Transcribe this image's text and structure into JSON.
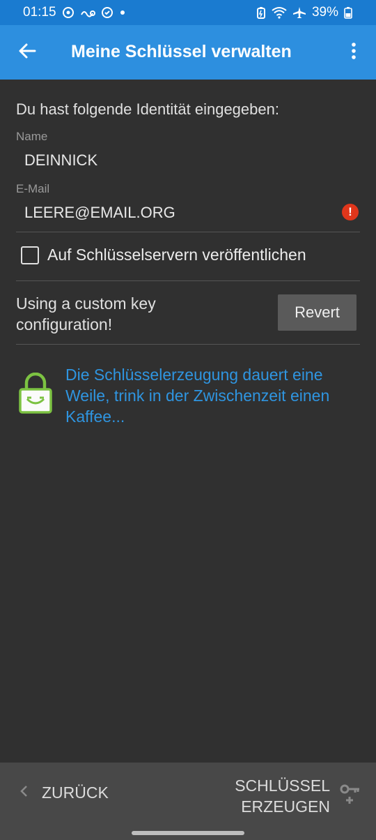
{
  "status_bar": {
    "time": "01:15",
    "battery": "39%",
    "icons": [
      "sync-icon",
      "link-icon",
      "vpn-icon",
      "dot-icon",
      "battery-saver-icon",
      "wifi-icon",
      "airplane-icon",
      "battery-icon"
    ]
  },
  "app_bar": {
    "title": "Meine Schlüssel verwalten",
    "back_icon": "arrow-back-icon",
    "menu_icon": "overflow-menu-icon"
  },
  "form": {
    "intro": "Du hast folgende Identität eingegeben:",
    "name_label": "Name",
    "name_value": "DEINNICK",
    "email_label": "E-Mail",
    "email_value": "LEERE@EMAIL.ORG",
    "email_error_icon": "error-icon",
    "publish_checkbox_label": "Auf Schlüsselservern veröffentlichen",
    "publish_checked": false,
    "custom_config_text": "Using a custom key configuration!",
    "revert_label": "Revert",
    "info_text": "Die Schlüsselerzeugung dauert eine Weile, trink in der Zwischenzeit einen Kaffee..."
  },
  "bottom_bar": {
    "back_label": "ZURÜCK",
    "create_label_line1": "SCHLÜSSEL",
    "create_label_line2": "ERZEUGEN"
  },
  "colors": {
    "primary": "#2d8fdf",
    "status_bar": "#1a7bd0",
    "background": "#303030",
    "accent_text": "#2f95e0",
    "error": "#e0361b",
    "lock_green": "#7cc242"
  }
}
